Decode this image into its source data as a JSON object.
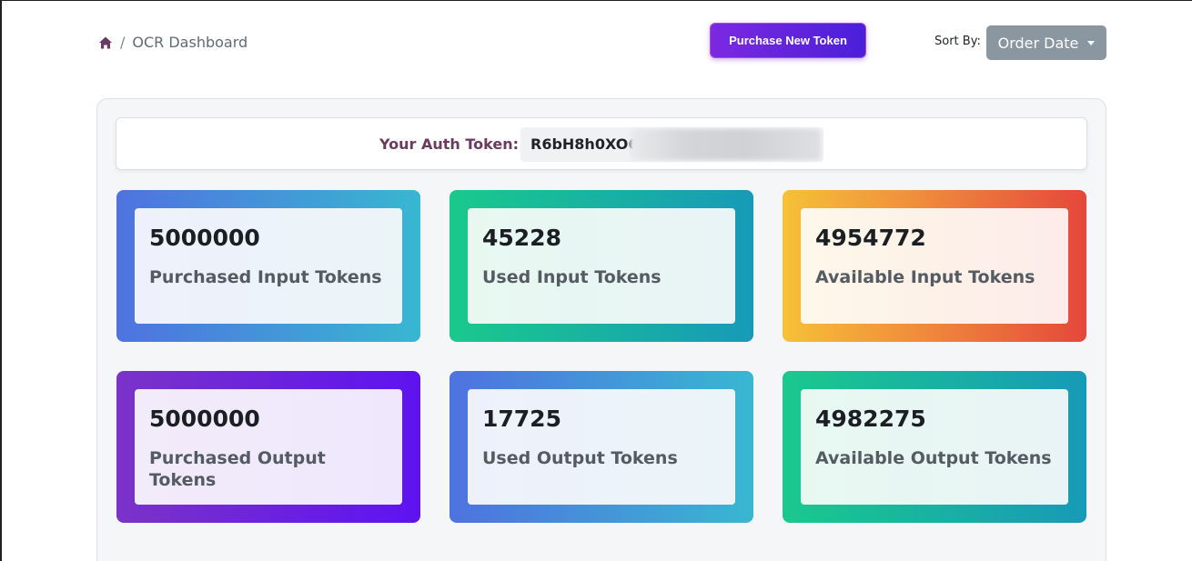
{
  "breadcrumb": {
    "icon": "home-icon",
    "separator": "/",
    "current": "OCR Dashboard"
  },
  "header": {
    "purchase_button": "Purchase New Token",
    "sort_label": "Sort By:",
    "sort_selected": "Order Date"
  },
  "auth": {
    "label": "Your Auth Token:",
    "token_visible": "R6bH8h0XO6"
  },
  "stats": [
    {
      "value": "5000000",
      "label": "Purchased Input Tokens"
    },
    {
      "value": "45228",
      "label": "Used Input Tokens"
    },
    {
      "value": "4954772",
      "label": "Available Input Tokens"
    },
    {
      "value": "5000000",
      "label": "Purchased Output Tokens"
    },
    {
      "value": "17725",
      "label": "Used Output Tokens"
    },
    {
      "value": "4982275",
      "label": "Available Output Tokens"
    }
  ],
  "colors": {
    "purchase_button": "#5a22dd",
    "sort_dropdown": "#8a96a0",
    "auth_label": "#6b3a60"
  }
}
